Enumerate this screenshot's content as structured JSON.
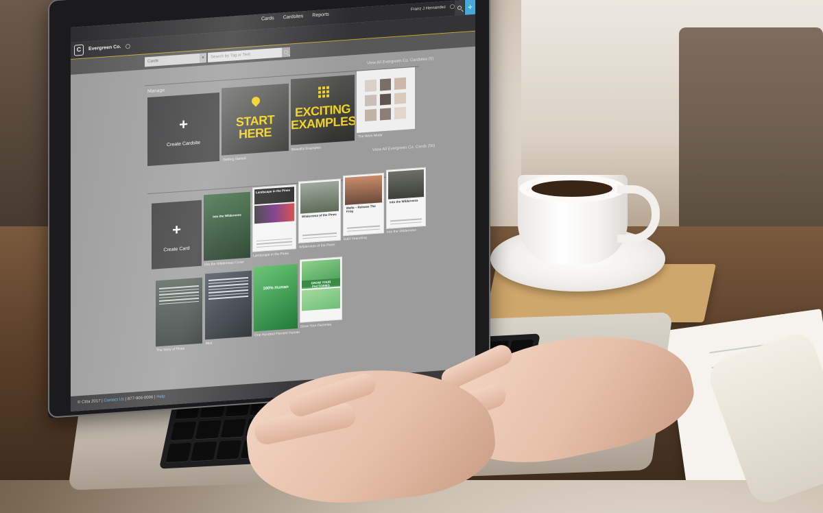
{
  "topbar": {
    "nav": [
      "Cards",
      "Cardsites",
      "Reports"
    ],
    "user_name": "Franz J Hernandez",
    "add_label": "+"
  },
  "brand": {
    "logo_letter": "C",
    "name": "Evergreen Co."
  },
  "filter": {
    "select_value": "Cards",
    "select_caret": "▾",
    "search_placeholder": "Search by Tag or Text"
  },
  "cardsites": {
    "view_all_label": "View All Evergreen Co. Cardsites (5)",
    "section_title": "Manage",
    "create_label": "Create Cardsite",
    "create_plus": "+",
    "tiles": [
      {
        "caption": "Getting Started",
        "lines": [
          "START",
          "HERE"
        ]
      },
      {
        "caption": "Beautiful Examples",
        "lines": [
          "EXCITING",
          "EXAMPLES"
        ]
      },
      {
        "caption": "The Work Mode"
      }
    ]
  },
  "cards": {
    "view_all_label": "View All Evergreen Co. Cards (50)",
    "create_label": "Create Card",
    "create_plus": "+",
    "row1": [
      {
        "caption": "Into the Wilderness Cover",
        "title": "Into the Wilderness"
      },
      {
        "caption": "Landscape in the Pines",
        "title": "Landscape in the Pines"
      },
      {
        "caption": "Wilderness of the Pines",
        "title": "Wilderness of the Pines"
      },
      {
        "caption": "Bald Searching",
        "title": "Mafia – Release The Frog"
      },
      {
        "caption": "Into the Wilderness",
        "title": "Into the Wilderness"
      }
    ],
    "row2": [
      {
        "caption": "The Story of Pines"
      },
      {
        "caption": "Mist"
      },
      {
        "caption": "One Hundred Percent Human",
        "title": "100% Human"
      },
      {
        "caption": "Grow Your Factories",
        "title": "GROW YOUR FACTORIES"
      }
    ]
  },
  "footer": {
    "copyright": "© Ctita 2017 |",
    "contact_link": "Contact Us",
    "phone": "| 877-906-0006 |",
    "help_link": "Help"
  },
  "colors": {
    "accent_yellow": "#f0d21e",
    "add_button_blue": "#48a8d8",
    "link_blue": "#62b4e2"
  }
}
